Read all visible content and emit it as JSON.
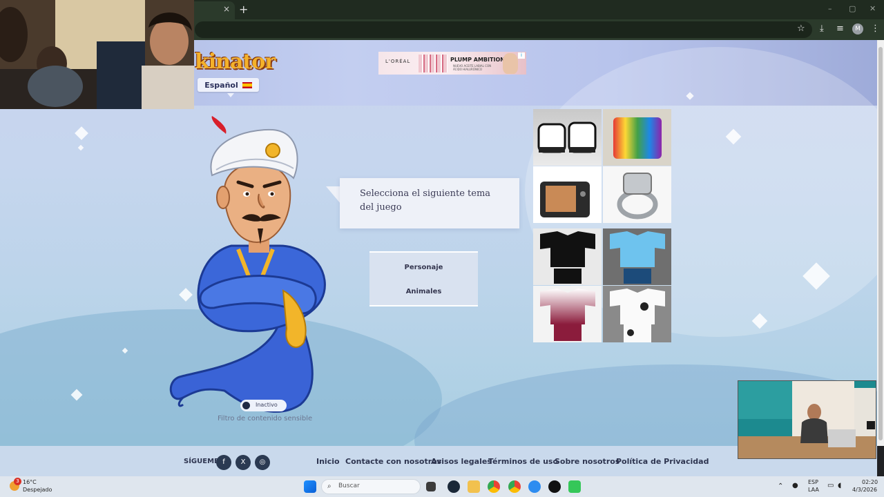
{
  "browser": {
    "tab_close": "×",
    "new_tab": "+",
    "window_controls": [
      "–",
      "▢",
      "✕"
    ],
    "toolbar_icons": [
      "star-icon",
      "download-icon",
      "queue-icon",
      "profile-avatar",
      "menu-icon"
    ],
    "avatar_letter": "M"
  },
  "site": {
    "logo": "kinator",
    "language": "Español",
    "ad_banner": {
      "brand": "L'ORÉAL",
      "headline": "PLUMP AMBITION",
      "subline": "NUEVO ACEITE LABIAL CON ÁCIDO HIALURÓNICO"
    },
    "question": "Selecciona el siguiente tema del juego",
    "answers": [
      "Personaje",
      "Animales"
    ],
    "toggle_label": "Inactivo",
    "filter_label": "Filtro de contenido sensible",
    "footer": {
      "follow": "SÍGUEME",
      "social": [
        "f",
        "X",
        "◎"
      ],
      "links": [
        "Inicio",
        "Contacte con nosotros",
        "Avisos legales",
        "Términos de uso",
        "Sobre nosotros",
        "Política de Privacidad"
      ]
    }
  },
  "taskbar": {
    "weather_temp": "16°C",
    "weather_desc": "Despejado",
    "weather_badge": "3",
    "search_placeholder": "Buscar",
    "lang_top": "ESP",
    "lang_bottom": "LAA",
    "time": "02:20",
    "date": "4/3/2026"
  },
  "colors": {
    "accent": "#2b3a52",
    "logo": "#f4b12a",
    "page_bg": "#c6d6ee"
  }
}
